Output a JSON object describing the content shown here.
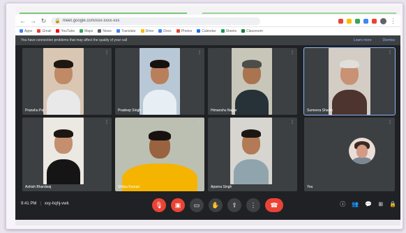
{
  "browser": {
    "url": "meet.google.com/xxx-xxxx-xxx",
    "bookmarks": [
      {
        "label": "Apps",
        "color": "#4285f4"
      },
      {
        "label": "Gmail",
        "color": "#ea4335"
      },
      {
        "label": "YouTube",
        "color": "#ff0000"
      },
      {
        "label": "Maps",
        "color": "#34a853"
      },
      {
        "label": "News",
        "color": "#5f6368"
      },
      {
        "label": "Translate",
        "color": "#4285f4"
      },
      {
        "label": "Drive",
        "color": "#fbbc04"
      },
      {
        "label": "Docs",
        "color": "#4285f4"
      },
      {
        "label": "Photos",
        "color": "#ea4335"
      },
      {
        "label": "Calendar",
        "color": "#1a73e8"
      },
      {
        "label": "Sheets",
        "color": "#0f9d58"
      },
      {
        "label": "Classroom",
        "color": "#188038"
      }
    ]
  },
  "meet": {
    "banner": {
      "text": "You have connection problems that may affect the quality of your call",
      "actions": [
        "Learn more",
        "Dismiss"
      ]
    },
    "tiles": [
      {
        "name": "Pranshu Pal",
        "speaking": false,
        "bg": "#d9c7b4",
        "skin": "#c08a66",
        "hair": "#1e1712",
        "shirt": "#e9e9e9"
      },
      {
        "name": "Pradeep Singh",
        "speaking": false,
        "bg": "#b9c8d6",
        "skin": "#b97f5b",
        "hair": "#17120f",
        "shirt": "#e7eef4"
      },
      {
        "name": "Himanshu Nagar",
        "speaking": false,
        "bg": "#c7c6b9",
        "skin": "#a9744f",
        "hair": "#4d4d4a",
        "shirt": "#263238"
      },
      {
        "name": "Sumeera Shaikh",
        "speaking": true,
        "bg": "#d3cdc6",
        "skin": "#c89274",
        "hair": "#e1dfdb",
        "shirt": "#4e342e"
      },
      {
        "name": "Ashish Bhardwaj",
        "speaking": false,
        "bg": "#ece8e2",
        "skin": "#c38f6e",
        "hair": "#1c1713",
        "shirt": "#151515"
      },
      {
        "name": "Shilpa Kumari",
        "speaking": false,
        "bg": "#bcc0b3",
        "skin": "#99633f",
        "hair": "#17120f",
        "shirt": "#f4b400"
      },
      {
        "name": "Aparna Singh",
        "speaking": false,
        "bg": "#d7d5cf",
        "skin": "#b27a55",
        "hair": "#1c1713",
        "shirt": "#90a4ae"
      },
      {
        "name": "You",
        "speaking": false,
        "bg": "#202124",
        "skin": "#d39b85",
        "hair": "#3b2a22",
        "shirt": "#7b8794"
      }
    ],
    "bottom": {
      "time": "9:41 PM",
      "meeting_code": "xxy-hqhj-vwk"
    },
    "controls": [
      {
        "icon": "mic-off-icon",
        "glyph": "🎙",
        "style": "red"
      },
      {
        "icon": "camera-off-icon",
        "glyph": "▣",
        "style": "red"
      },
      {
        "icon": "captions-icon",
        "glyph": "▭",
        "style": ""
      },
      {
        "icon": "raise-hand-icon",
        "glyph": "✋",
        "style": ""
      },
      {
        "icon": "present-icon",
        "glyph": "⇧",
        "style": ""
      },
      {
        "icon": "more-options-icon",
        "glyph": "⋮",
        "style": ""
      },
      {
        "icon": "end-call-icon",
        "glyph": "☎",
        "style": "end"
      }
    ],
    "side_icons": [
      {
        "icon": "info-icon",
        "glyph": "ⓘ"
      },
      {
        "icon": "people-icon",
        "glyph": "👥"
      },
      {
        "icon": "chat-icon",
        "glyph": "💬"
      },
      {
        "icon": "activities-icon",
        "glyph": "⊞"
      },
      {
        "icon": "lock-icon",
        "glyph": "🔒"
      }
    ]
  }
}
